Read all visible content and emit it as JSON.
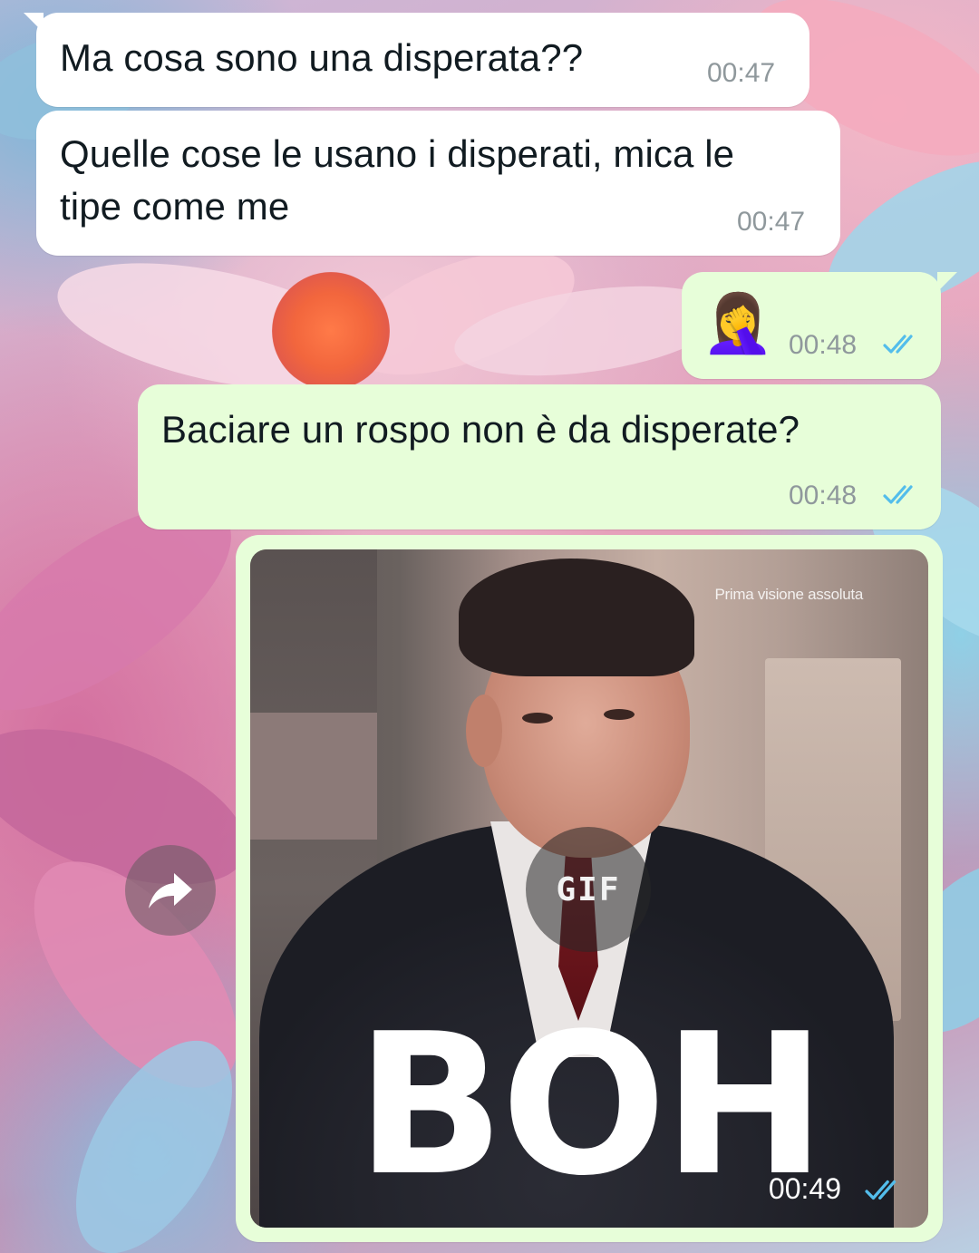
{
  "messages": [
    {
      "direction": "incoming",
      "text": "Ma cosa sono una disperata??",
      "time": "00:47"
    },
    {
      "direction": "incoming",
      "text_line1": "Quelle cose le usano i disperati, mica le",
      "text_line2": "tipe come me",
      "time": "00:47"
    },
    {
      "direction": "outgoing",
      "emoji": "🤦‍♀️",
      "time": "00:48",
      "status": "read"
    },
    {
      "direction": "outgoing",
      "text": "Baciare un rospo non è da disperate?",
      "time": "00:48",
      "status": "read"
    },
    {
      "direction": "outgoing",
      "type": "gif",
      "badge": "GIF",
      "overlay_text": "BOH",
      "caption": "Prima visione assoluta",
      "time": "00:49",
      "status": "read"
    }
  ],
  "colors": {
    "incoming_bubble": "#ffffff",
    "outgoing_bubble": "#e7fed9",
    "read_ticks": "#53bdeb",
    "timestamp": "#8f989c"
  },
  "icons": {
    "read_status": "double-check-icon",
    "forward": "forward-arrow-icon"
  }
}
